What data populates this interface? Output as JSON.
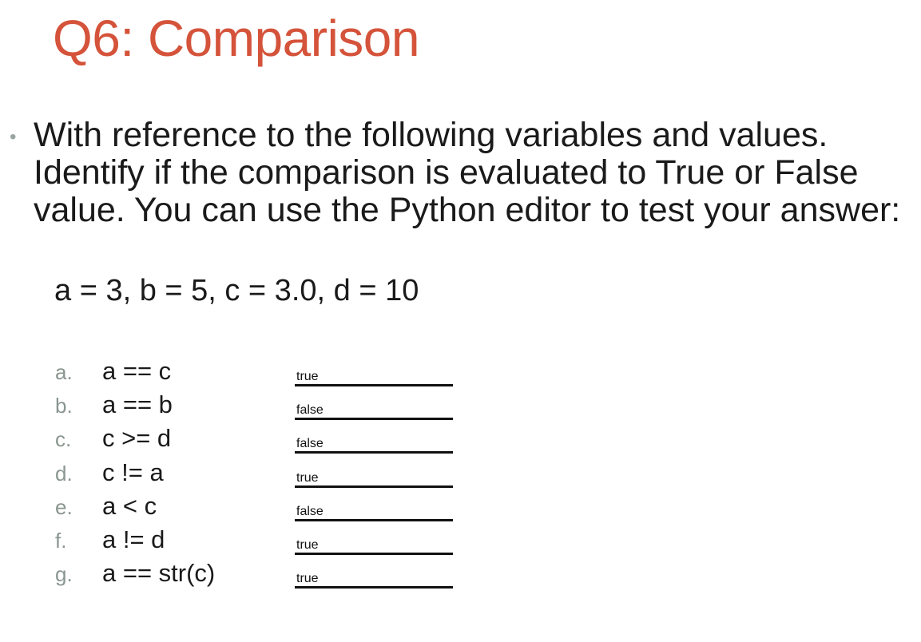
{
  "slide": {
    "title": "Q6: Comparison",
    "bullet_symbol": "•",
    "bullet_text": "With reference to the following variables and values. Identify if the comparison is evaluated to True or False value. You can use the Python editor to test your answer:",
    "variables": "a = 3, b = 5, c = 3.0, d = 10"
  },
  "questions": [
    {
      "letter": "a.",
      "expression": "a == c",
      "answer": "true"
    },
    {
      "letter": "b.",
      "expression": "a == b",
      "answer": "false"
    },
    {
      "letter": "c.",
      "expression": "c >= d",
      "answer": "false"
    },
    {
      "letter": "d.",
      "expression": "c != a",
      "answer": "true"
    },
    {
      "letter": "e.",
      "expression": "a < c",
      "answer": "false"
    },
    {
      "letter": "f.",
      "expression": "a != d",
      "answer": "true"
    },
    {
      "letter": "g.",
      "expression": "a == str(c)",
      "answer": "true"
    }
  ],
  "colors": {
    "title": "#d4533a",
    "bullet": "#9aa5a0",
    "letter": "#8a9690"
  }
}
